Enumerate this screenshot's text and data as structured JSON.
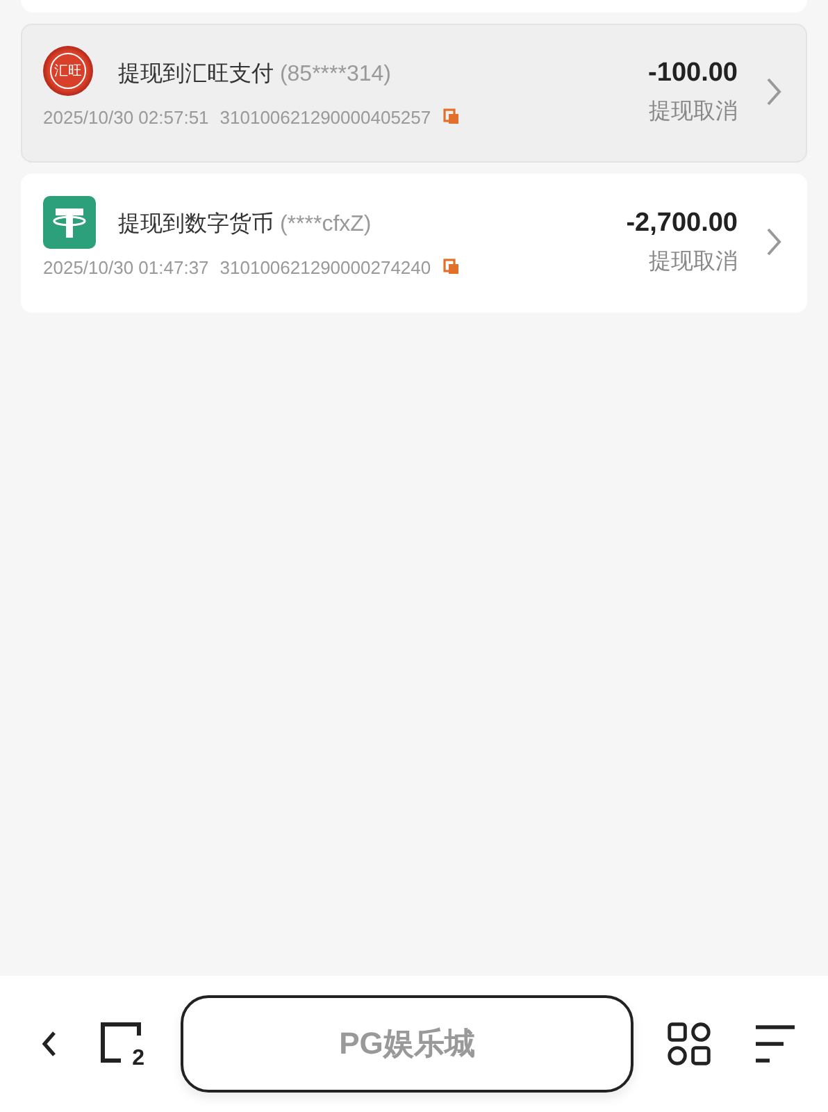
{
  "records": [
    {
      "kind": "wallet",
      "icon_text": "汇旺",
      "title": "提现到汇旺支付",
      "account": "(85****314)",
      "time": "2025/10/30 02:57:51",
      "order_no": "310100621290000405257",
      "amount": "-100.00",
      "status": "提现取消",
      "selected": true
    },
    {
      "kind": "crypto",
      "title": "提现到数字货币",
      "account": "(****cfxZ)",
      "time": "2025/10/30 01:47:37",
      "order_no": "310100621290000274240",
      "amount": "-2,700.00",
      "status": "提现取消",
      "selected": false
    }
  ],
  "browser_bar": {
    "tab_count": "2",
    "address": "PG娱乐城"
  }
}
